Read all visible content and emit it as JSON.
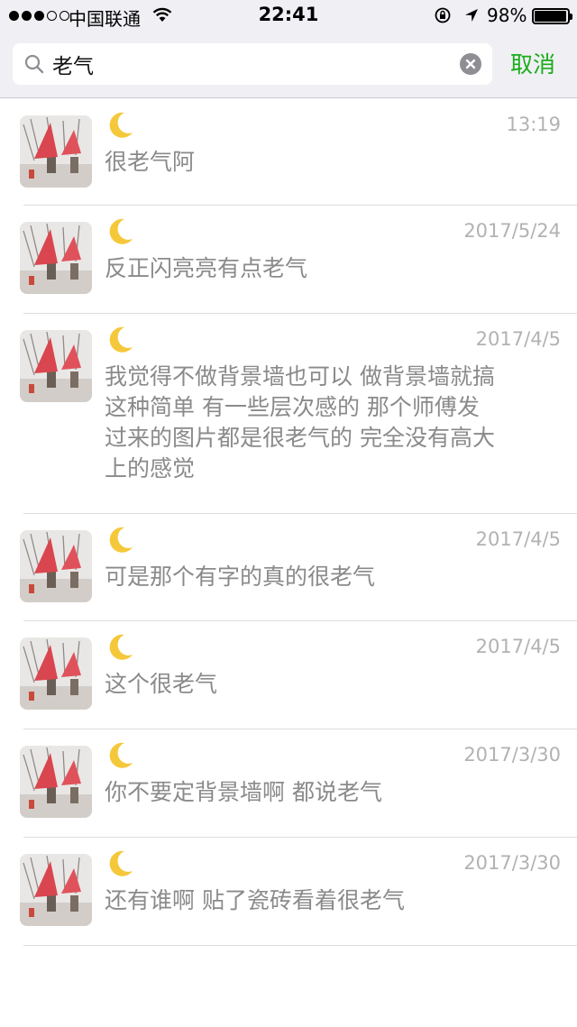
{
  "status_bar": {
    "carrier": "中国联通",
    "time": "22:41",
    "battery": "98%",
    "battery_level": 0.98,
    "signal_bars": 3
  },
  "search": {
    "query": "老气",
    "cancel_label": "取消"
  },
  "results": [
    {
      "sender": "🌙",
      "time": "13:19",
      "text": "很老气阿"
    },
    {
      "sender": "🌙",
      "time": "2017/5/24",
      "text": "反正闪亮亮有点老气"
    },
    {
      "sender": "🌙",
      "time": "2017/4/5",
      "text": "我觉得不做背景墙也可以 做背景墙就搞这种简单 有一些层次感的 那个师傅发过来的图片都是很老气的 完全没有高大上的感觉"
    },
    {
      "sender": "🌙",
      "time": "2017/4/5",
      "text": "可是那个有字的真的很老气"
    },
    {
      "sender": "🌙",
      "time": "2017/4/5",
      "text": "这个很老气"
    },
    {
      "sender": "🌙",
      "time": "2017/3/30",
      "text": "你不要定背景墙啊 都说老气"
    },
    {
      "sender": "🌙",
      "time": "2017/3/30",
      "text": "还有谁啊 贴了瓷砖看着很老气"
    }
  ],
  "colors": {
    "accent": "#1aad19",
    "background": "#efeff4",
    "time_text": "#b2b2b2",
    "message_text": "#8a8a8a"
  },
  "icons": {
    "avatar": "avatar-photo-red-umbrellas",
    "sender": "moon-icon",
    "search": "search-icon",
    "clear": "clear-icon"
  }
}
